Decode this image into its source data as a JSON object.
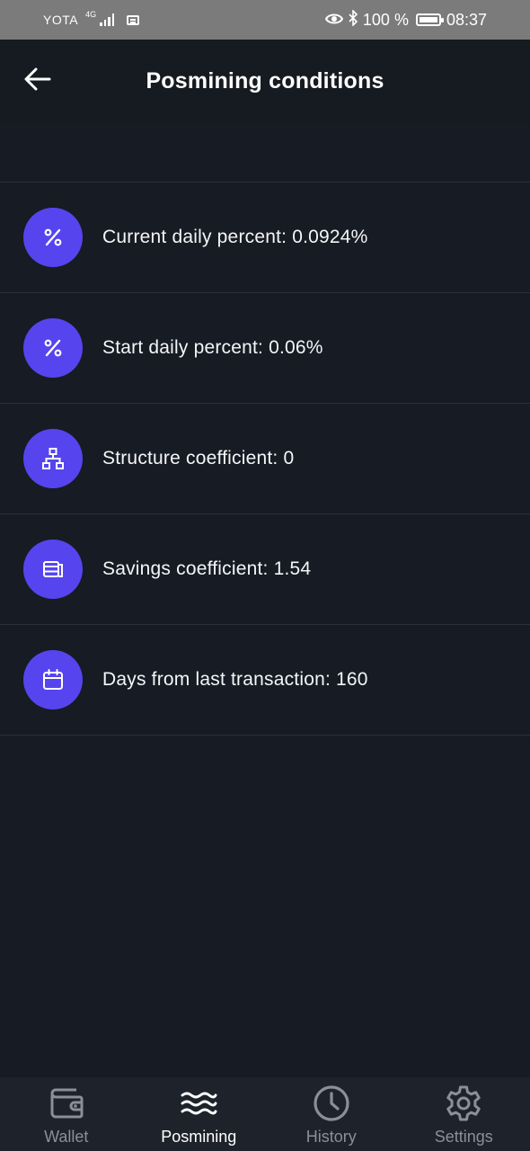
{
  "status_bar": {
    "carrier": "YOTA",
    "network": "4G",
    "battery": "100 %",
    "time": "08:37"
  },
  "header": {
    "title": "Posmining conditions",
    "back_icon": "arrow-left-icon"
  },
  "conditions": [
    {
      "icon": "percent-icon",
      "label": "Current daily percent: 0.0924%"
    },
    {
      "icon": "percent-icon",
      "label": "Start daily percent: 0.06%"
    },
    {
      "icon": "hierarchy-icon",
      "label": "Structure coefficient: 0"
    },
    {
      "icon": "coins-stack-icon",
      "label": "Savings coefficient: 1.54"
    },
    {
      "icon": "calendar-icon",
      "label": "Days from last transaction: 160"
    }
  ],
  "bottom_nav": {
    "items": [
      {
        "icon": "wallet-icon",
        "label": "Wallet",
        "active": false
      },
      {
        "icon": "waves-icon",
        "label": "Posmining",
        "active": true
      },
      {
        "icon": "clock-icon",
        "label": "History",
        "active": false
      },
      {
        "icon": "gear-icon",
        "label": "Settings",
        "active": false
      }
    ]
  },
  "colors": {
    "background": "#171b23",
    "accent": "#5645ee",
    "nav_background": "#1e222b",
    "status_bar": "#7b7b7b"
  }
}
